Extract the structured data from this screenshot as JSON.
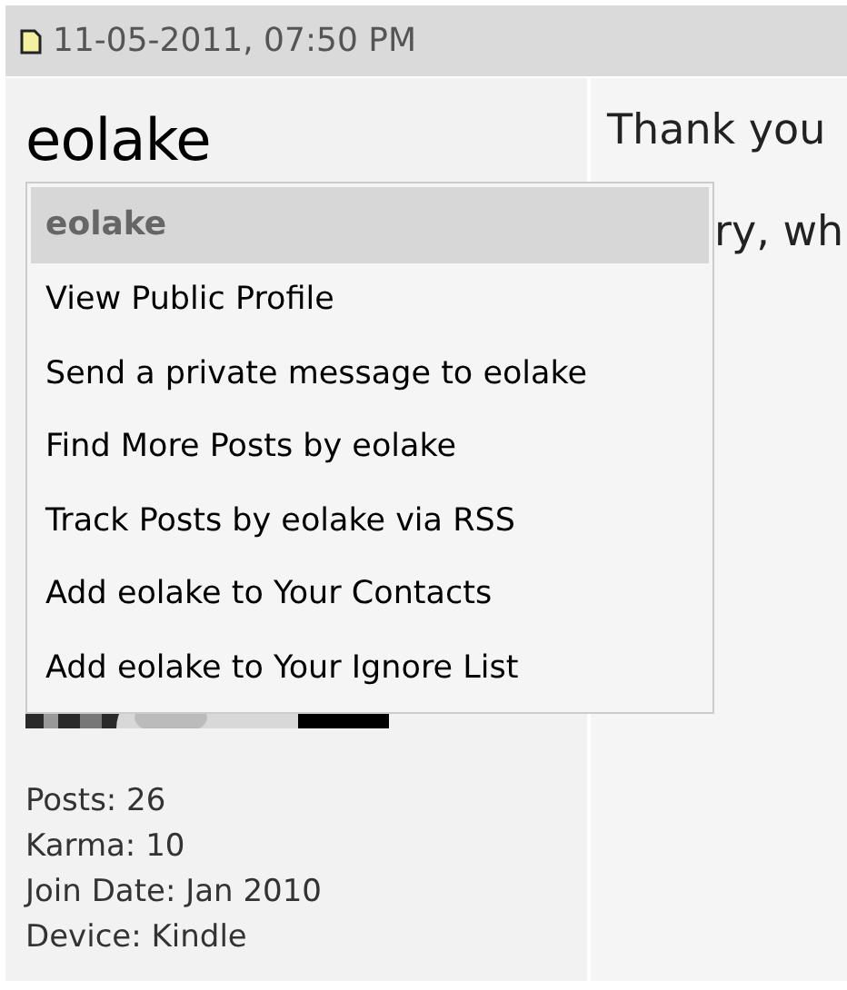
{
  "header": {
    "date": "11-05-2011, 07:50 PM"
  },
  "user": {
    "username": "eolake",
    "info": [
      "Posts: 26",
      "Karma: 10",
      "Join Date: Jan 2010",
      "Device: Kindle"
    ]
  },
  "menu": {
    "title": "eolake",
    "items": [
      {
        "label": "View Public Profile"
      },
      {
        "label": "Send a private message to eolake"
      },
      {
        "label": "Find More Posts by eolake"
      },
      {
        "label": "Track Posts by eolake via RSS"
      },
      {
        "label": "Add eolake to Your Contacts"
      },
      {
        "label": "Add eolake to Your Ignore List"
      }
    ]
  },
  "message": {
    "lines": [
      "Thank you",
      "ry, wh"
    ]
  }
}
